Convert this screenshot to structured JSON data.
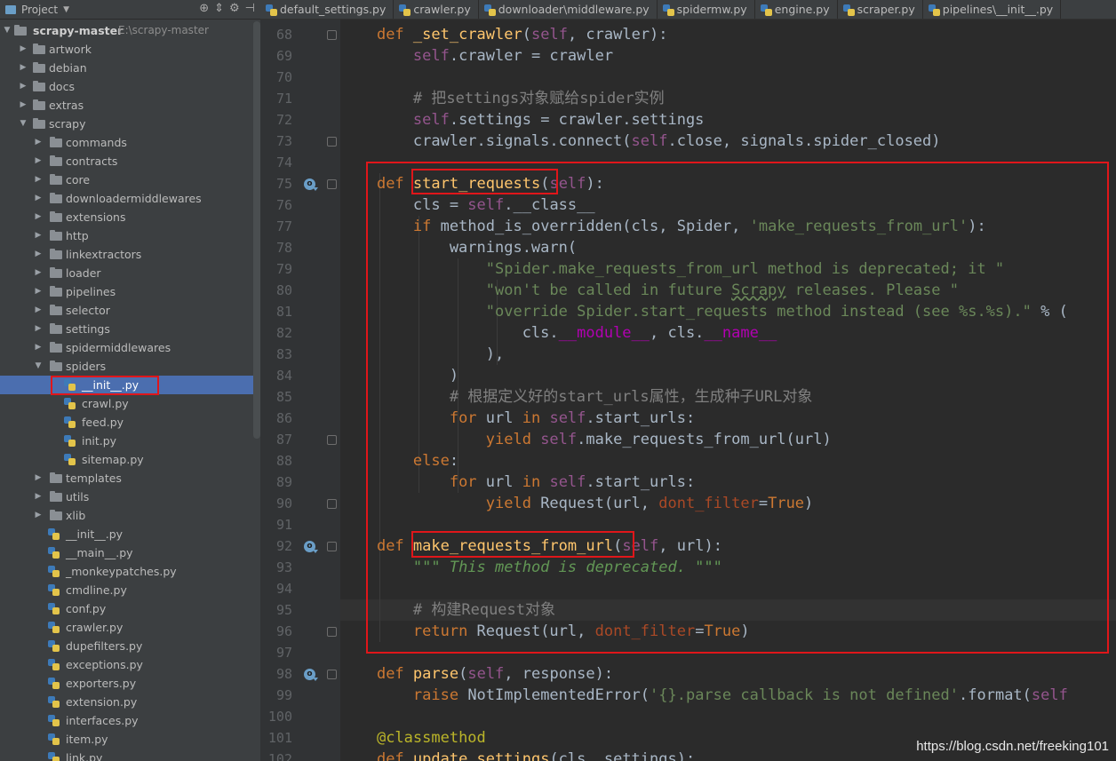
{
  "project": {
    "title": "Project",
    "root_name": "scrapy-master",
    "root_path": "E:\\scrapy-master"
  },
  "tree": [
    {
      "label": "artwork",
      "type": "folder",
      "level": 1,
      "arrow": "right"
    },
    {
      "label": "debian",
      "type": "folder",
      "level": 1,
      "arrow": "right"
    },
    {
      "label": "docs",
      "type": "folder",
      "level": 1,
      "arrow": "right"
    },
    {
      "label": "extras",
      "type": "folder",
      "level": 1,
      "arrow": "right"
    },
    {
      "label": "scrapy",
      "type": "folder",
      "level": 1,
      "arrow": "down"
    },
    {
      "label": "commands",
      "type": "folder",
      "level": 2,
      "arrow": "right"
    },
    {
      "label": "contracts",
      "type": "folder",
      "level": 2,
      "arrow": "right"
    },
    {
      "label": "core",
      "type": "folder",
      "level": 2,
      "arrow": "right"
    },
    {
      "label": "downloadermiddlewares",
      "type": "folder",
      "level": 2,
      "arrow": "right"
    },
    {
      "label": "extensions",
      "type": "folder",
      "level": 2,
      "arrow": "right"
    },
    {
      "label": "http",
      "type": "folder",
      "level": 2,
      "arrow": "right"
    },
    {
      "label": "linkextractors",
      "type": "folder",
      "level": 2,
      "arrow": "right"
    },
    {
      "label": "loader",
      "type": "folder",
      "level": 2,
      "arrow": "right"
    },
    {
      "label": "pipelines",
      "type": "folder",
      "level": 2,
      "arrow": "right"
    },
    {
      "label": "selector",
      "type": "folder",
      "level": 2,
      "arrow": "right"
    },
    {
      "label": "settings",
      "type": "folder",
      "level": 2,
      "arrow": "right"
    },
    {
      "label": "spidermiddlewares",
      "type": "folder",
      "level": 2,
      "arrow": "right"
    },
    {
      "label": "spiders",
      "type": "folder",
      "level": 2,
      "arrow": "down"
    },
    {
      "label": "__init__.py",
      "type": "file",
      "level": 3,
      "selected": true
    },
    {
      "label": "crawl.py",
      "type": "file",
      "level": 3
    },
    {
      "label": "feed.py",
      "type": "file",
      "level": 3
    },
    {
      "label": "init.py",
      "type": "file",
      "level": 3
    },
    {
      "label": "sitemap.py",
      "type": "file",
      "level": 3
    },
    {
      "label": "templates",
      "type": "folder",
      "level": 2,
      "arrow": "right"
    },
    {
      "label": "utils",
      "type": "folder",
      "level": 2,
      "arrow": "right"
    },
    {
      "label": "xlib",
      "type": "folder",
      "level": 2,
      "arrow": "right"
    },
    {
      "label": "__init__.py",
      "type": "file",
      "level": 2
    },
    {
      "label": "__main__.py",
      "type": "file",
      "level": 2
    },
    {
      "label": "_monkeypatches.py",
      "type": "file",
      "level": 2
    },
    {
      "label": "cmdline.py",
      "type": "file",
      "level": 2
    },
    {
      "label": "conf.py",
      "type": "file",
      "level": 2
    },
    {
      "label": "crawler.py",
      "type": "file",
      "level": 2
    },
    {
      "label": "dupefilters.py",
      "type": "file",
      "level": 2
    },
    {
      "label": "exceptions.py",
      "type": "file",
      "level": 2
    },
    {
      "label": "exporters.py",
      "type": "file",
      "level": 2
    },
    {
      "label": "extension.py",
      "type": "file",
      "level": 2
    },
    {
      "label": "interfaces.py",
      "type": "file",
      "level": 2
    },
    {
      "label": "item.py",
      "type": "file",
      "level": 2
    },
    {
      "label": "link.py",
      "type": "file",
      "level": 2
    }
  ],
  "tabs": [
    {
      "label": "default_settings.py"
    },
    {
      "label": "crawler.py"
    },
    {
      "label": "downloader\\middleware.py"
    },
    {
      "label": "spidermw.py"
    },
    {
      "label": "engine.py"
    },
    {
      "label": "scraper.py"
    },
    {
      "label": "pipelines\\__init__.py"
    }
  ],
  "gutter": {
    "line_numbers": [
      "68",
      "69",
      "70",
      "71",
      "72",
      "73",
      "74",
      "75",
      "76",
      "77",
      "78",
      "79",
      "80",
      "81",
      "82",
      "83",
      "84",
      "85",
      "86",
      "87",
      "88",
      "89",
      "90",
      "91",
      "92",
      "93",
      "94",
      "95",
      "96",
      "97",
      "98",
      "99",
      "100",
      "101",
      "102"
    ],
    "override_icon_lines": [
      "75",
      "92",
      "98"
    ]
  },
  "code": {
    "current_line": "95",
    "lines": [
      [
        {
          "t": "    "
        },
        {
          "t": "def ",
          "c": "kw"
        },
        {
          "t": "_set_crawler",
          "c": "fn"
        },
        {
          "t": "("
        },
        {
          "t": "self",
          "c": "self"
        },
        {
          "t": ", crawler):"
        }
      ],
      [
        {
          "t": "        "
        },
        {
          "t": "self",
          "c": "self"
        },
        {
          "t": ".crawler = crawler"
        }
      ],
      [],
      [
        {
          "t": "        "
        },
        {
          "t": "# 把settings对象赋给spider实例",
          "c": "cm"
        }
      ],
      [
        {
          "t": "        "
        },
        {
          "t": "self",
          "c": "self"
        },
        {
          "t": ".settings = crawler.settings"
        }
      ],
      [
        {
          "t": "        crawler.signals.connect("
        },
        {
          "t": "self",
          "c": "self"
        },
        {
          "t": ".close, signals.spider_closed)"
        }
      ],
      [],
      [
        {
          "t": "    "
        },
        {
          "t": "def ",
          "c": "kw"
        },
        {
          "t": "start_requests",
          "c": "fn"
        },
        {
          "t": "("
        },
        {
          "t": "self",
          "c": "self"
        },
        {
          "t": "):"
        }
      ],
      [
        {
          "t": "        cls = "
        },
        {
          "t": "self",
          "c": "self"
        },
        {
          "t": "."
        },
        {
          "t": "__class__",
          "c": "plain"
        }
      ],
      [
        {
          "t": "        "
        },
        {
          "t": "if ",
          "c": "kw"
        },
        {
          "t": "method_is_overridden(cls, Spider, "
        },
        {
          "t": "'make_requests_from_url'",
          "c": "str"
        },
        {
          "t": "):"
        }
      ],
      [
        {
          "t": "            warnings.warn("
        }
      ],
      [
        {
          "t": "                "
        },
        {
          "t": "\"Spider.make_requests_from_url method is deprecated; it \"",
          "c": "str"
        }
      ],
      [
        {
          "t": "                "
        },
        {
          "t": "\"won't be called in future ",
          "c": "str"
        },
        {
          "t": "Scrapy",
          "c": "str wavy"
        },
        {
          "t": " releases. Please \"",
          "c": "str"
        }
      ],
      [
        {
          "t": "                "
        },
        {
          "t": "\"override Spider.start_requests method instead (see %s.%s).\"",
          "c": "str"
        },
        {
          "t": " % ("
        }
      ],
      [
        {
          "t": "                    cls."
        },
        {
          "t": "__module__",
          "c": "mag"
        },
        {
          "t": ", cls."
        },
        {
          "t": "__name__",
          "c": "mag"
        }
      ],
      [
        {
          "t": "                ),"
        }
      ],
      [
        {
          "t": "            )"
        }
      ],
      [
        {
          "t": "            "
        },
        {
          "t": "# 根据定义好的start_urls属性，生成种子URL对象",
          "c": "cm"
        }
      ],
      [
        {
          "t": "            "
        },
        {
          "t": "for ",
          "c": "kw"
        },
        {
          "t": "url "
        },
        {
          "t": "in ",
          "c": "kw"
        },
        {
          "t": "self",
          "c": "self"
        },
        {
          "t": ".start_urls:"
        }
      ],
      [
        {
          "t": "                "
        },
        {
          "t": "yield ",
          "c": "kw"
        },
        {
          "t": "self",
          "c": "self"
        },
        {
          "t": ".make_requests_from_url(url)"
        }
      ],
      [
        {
          "t": "        "
        },
        {
          "t": "else",
          "c": "kw"
        },
        {
          "t": ":"
        }
      ],
      [
        {
          "t": "            "
        },
        {
          "t": "for ",
          "c": "kw"
        },
        {
          "t": "url "
        },
        {
          "t": "in ",
          "c": "kw"
        },
        {
          "t": "self",
          "c": "self"
        },
        {
          "t": ".start_urls:"
        }
      ],
      [
        {
          "t": "                "
        },
        {
          "t": "yield ",
          "c": "kw"
        },
        {
          "t": "Request(url, "
        },
        {
          "t": "dont_filter",
          "c": "kwarg"
        },
        {
          "t": "="
        },
        {
          "t": "True",
          "c": "kw"
        },
        {
          "t": ")"
        }
      ],
      [],
      [
        {
          "t": "    "
        },
        {
          "t": "def ",
          "c": "kw"
        },
        {
          "t": "make_requests_from_url",
          "c": "fn"
        },
        {
          "t": "("
        },
        {
          "t": "self",
          "c": "self"
        },
        {
          "t": ", url):"
        }
      ],
      [
        {
          "t": "        "
        },
        {
          "t": "\"\"\" This method is deprecated. \"\"\"",
          "c": "doc"
        }
      ],
      [],
      [
        {
          "t": "        "
        },
        {
          "t": "# 构建Request对象",
          "c": "cm"
        }
      ],
      [
        {
          "t": "        "
        },
        {
          "t": "return ",
          "c": "kw"
        },
        {
          "t": "Request(url, "
        },
        {
          "t": "dont_filter",
          "c": "kwarg"
        },
        {
          "t": "="
        },
        {
          "t": "True",
          "c": "kw"
        },
        {
          "t": ")"
        }
      ],
      [],
      [
        {
          "t": "    "
        },
        {
          "t": "def ",
          "c": "kw"
        },
        {
          "t": "parse",
          "c": "fn"
        },
        {
          "t": "("
        },
        {
          "t": "self",
          "c": "self"
        },
        {
          "t": ", response):"
        }
      ],
      [
        {
          "t": "        "
        },
        {
          "t": "raise ",
          "c": "kw"
        },
        {
          "t": "NotImplementedError("
        },
        {
          "t": "'{}.parse callback is not defined'",
          "c": "str"
        },
        {
          "t": ".format("
        },
        {
          "t": "self",
          "c": "self"
        }
      ],
      [],
      [
        {
          "t": "    "
        },
        {
          "t": "@classmethod",
          "c": "dec"
        }
      ],
      [
        {
          "t": "    "
        },
        {
          "t": "def ",
          "c": "kw"
        },
        {
          "t": "update_settings",
          "c": "fn"
        },
        {
          "t": "(cls, settings):"
        }
      ]
    ]
  },
  "watermark": "https://blog.csdn.net/freeking101",
  "colors": {
    "highlight_box": "#e0161a",
    "selection": "#4b6eaf",
    "editor_bg": "#2b2b2b"
  }
}
